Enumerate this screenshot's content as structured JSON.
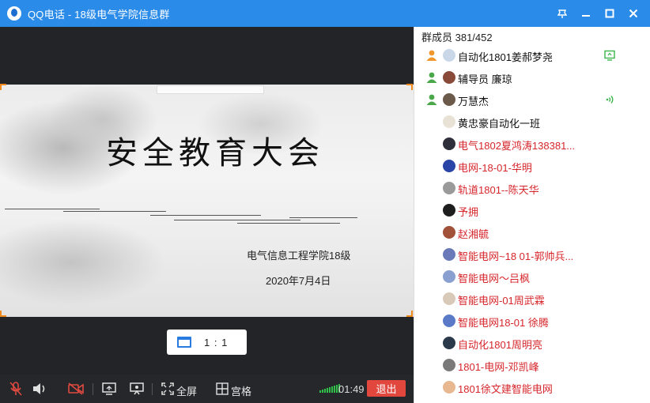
{
  "window": {
    "title": "QQ电话 - 18级电气学院信息群",
    "controls": [
      "pin-icon",
      "minimize-icon",
      "maximize-icon",
      "close-icon"
    ]
  },
  "slide": {
    "title": "安全教育大会",
    "subtitle": "电气信息工程学院18级",
    "date": "2020年7月4日"
  },
  "view_mode": {
    "ratio_label": "1 : 1"
  },
  "toolbar": {
    "fullscreen_label": "全屏",
    "grid_label": "宫格",
    "timer": "01:49",
    "exit_label": "退出"
  },
  "members": {
    "header": "群成员 381/452",
    "items": [
      {
        "name": "自动化1801姜郝梦尧",
        "color": "dark",
        "role": "admin",
        "status": "screen-share-icon"
      },
      {
        "name": "辅导员 廉琼",
        "color": "dark",
        "role": "owner",
        "status": ""
      },
      {
        "name": "万慧杰",
        "color": "dark",
        "role": "owner",
        "status": "speaking-icon"
      },
      {
        "name": "黄忠豪自动化一班",
        "color": "dark",
        "role": "",
        "status": ""
      },
      {
        "name": "电气1802夏鸿涛138381...",
        "color": "red",
        "role": "",
        "status": ""
      },
      {
        "name": "电网-18-01-华明",
        "color": "red",
        "role": "",
        "status": ""
      },
      {
        "name": "轨道1801--陈天华",
        "color": "red",
        "role": "",
        "status": ""
      },
      {
        "name": "予拥",
        "color": "red",
        "role": "",
        "status": ""
      },
      {
        "name": "赵湘毓",
        "color": "red",
        "role": "",
        "status": ""
      },
      {
        "name": "智能电网~18  01-郭帅兵...",
        "color": "red",
        "role": "",
        "status": ""
      },
      {
        "name": "智能电网～吕枫",
        "color": "red",
        "role": "",
        "status": ""
      },
      {
        "name": "智能电网-01周武霖",
        "color": "red",
        "role": "",
        "status": ""
      },
      {
        "name": "智能电网18-01   徐腾",
        "color": "red",
        "role": "",
        "status": ""
      },
      {
        "name": "自动化1801周明亮",
        "color": "red",
        "role": "",
        "status": ""
      },
      {
        "name": "1801-电网-邓凯峰",
        "color": "red",
        "role": "",
        "status": ""
      },
      {
        "name": "1801徐文建智能电网",
        "color": "red",
        "role": "",
        "status": ""
      }
    ]
  },
  "colors": {
    "titlebar": "#2a8be8",
    "exit": "#e2473e",
    "member_red": "#d6262b",
    "accent_orange": "#f08a1c"
  }
}
